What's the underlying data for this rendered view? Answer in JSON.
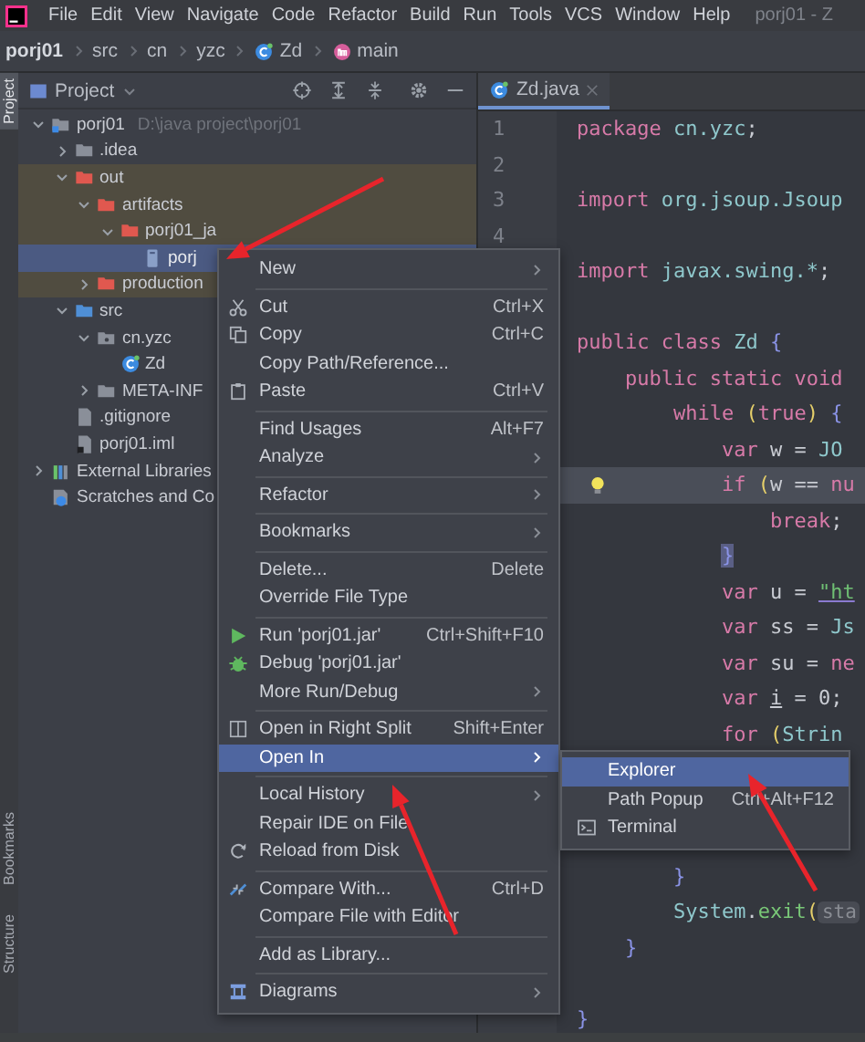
{
  "menubar": {
    "items": [
      "File",
      "Edit",
      "View",
      "Navigate",
      "Code",
      "Refactor",
      "Build",
      "Run",
      "Tools",
      "VCS",
      "Window",
      "Help"
    ],
    "title": "porj01 - Z"
  },
  "breadcrumbs": [
    {
      "label": "porj01",
      "kind": "project"
    },
    {
      "label": "src",
      "kind": "folder"
    },
    {
      "label": "cn",
      "kind": "folder"
    },
    {
      "label": "yzc",
      "kind": "folder"
    },
    {
      "label": "Zd",
      "kind": "class"
    },
    {
      "label": "main",
      "kind": "method"
    }
  ],
  "tool_stripe": {
    "top": [
      {
        "label": "Project",
        "selected": true
      }
    ],
    "bottom": [
      {
        "label": "Bookmarks",
        "selected": false
      },
      {
        "label": "Structure",
        "selected": false
      }
    ]
  },
  "project_panel": {
    "title": "Project",
    "tree": [
      {
        "label": "porj01",
        "path": "D:\\java project\\porj01",
        "kind": "module",
        "expanded": true,
        "excluded": false,
        "selected": false,
        "children": [
          {
            "label": ".idea",
            "kind": "folder",
            "expanded": false,
            "excluded": false,
            "selected": false
          },
          {
            "label": "out",
            "kind": "folder",
            "expanded": true,
            "excluded": true,
            "selected": false,
            "children": [
              {
                "label": "artifacts",
                "kind": "folder",
                "expanded": true,
                "excluded": true,
                "selected": false,
                "children": [
                  {
                    "label": "porj01_ja",
                    "kind": "folder",
                    "expanded": true,
                    "excluded": true,
                    "selected": false,
                    "children": [
                      {
                        "label": "porj",
                        "kind": "jar",
                        "excluded": true,
                        "selected": true
                      }
                    ]
                  }
                ]
              },
              {
                "label": "production",
                "kind": "folder",
                "expanded": false,
                "excluded": true,
                "selected": false
              }
            ]
          },
          {
            "label": "src",
            "kind": "source",
            "expanded": true,
            "excluded": false,
            "selected": false,
            "children": [
              {
                "label": "cn.yzc",
                "kind": "package",
                "expanded": true,
                "excluded": false,
                "selected": false,
                "children": [
                  {
                    "label": "Zd",
                    "kind": "class",
                    "excluded": false,
                    "selected": false
                  }
                ]
              },
              {
                "label": "META-INF",
                "kind": "folder",
                "expanded": false,
                "excluded": false,
                "selected": false
              }
            ]
          },
          {
            "label": ".gitignore",
            "kind": "file",
            "excluded": false,
            "selected": false
          },
          {
            "label": "porj01.iml",
            "kind": "iml",
            "excluded": false,
            "selected": false
          }
        ]
      },
      {
        "label": "External Libraries",
        "kind": "libraries",
        "expanded": false,
        "excluded": false,
        "selected": false
      },
      {
        "label": "Scratches and Co",
        "kind": "scratches",
        "excluded": false,
        "selected": false
      }
    ]
  },
  "editor": {
    "tabs": [
      {
        "label": "Zd.java",
        "selected": true
      }
    ],
    "line_numbers": [
      "1",
      "2",
      "3",
      "4"
    ],
    "lines": [
      {
        "current": false,
        "tokens": [
          {
            "text": "package",
            "kind": "kw"
          },
          {
            "text": " cn.yzc",
            "kind": "id"
          },
          {
            "text": ";",
            "kind": "plain"
          }
        ]
      },
      {
        "current": false
      },
      {
        "current": false,
        "tokens": [
          {
            "text": "import",
            "kind": "kw"
          },
          {
            "text": " org.jsoup.Jsoup",
            "kind": "id"
          }
        ]
      },
      {
        "current": false
      },
      {
        "current": false,
        "tokens": [
          {
            "text": "import",
            "kind": "kw"
          },
          {
            "text": " javax.swing.*",
            "kind": "id"
          },
          {
            "text": ";",
            "kind": "plain"
          }
        ]
      },
      {
        "current": false
      },
      {
        "current": false,
        "tokens": [
          {
            "text": "public class",
            "kind": "kw"
          },
          {
            "text": " Zd",
            "kind": "id"
          },
          {
            "text": " {",
            "kind": "brace"
          }
        ]
      },
      {
        "current": false,
        "tokens": [
          {
            "text": "    public static void",
            "kind": "kw"
          }
        ]
      },
      {
        "current": false,
        "tokens": [
          {
            "text": "        while",
            "kind": "kw"
          },
          {
            "text": " (",
            "kind": "paren"
          },
          {
            "text": "true",
            "kind": "kw"
          },
          {
            "text": ")",
            "kind": "paren"
          },
          {
            "text": " {",
            "kind": "brace"
          }
        ]
      },
      {
        "current": false,
        "tokens": [
          {
            "text": "            var",
            "kind": "kw"
          },
          {
            "text": " w = ",
            "kind": "plain"
          },
          {
            "text": "JO",
            "kind": "id"
          }
        ]
      },
      {
        "current": true,
        "tokens": [
          {
            "text": "            if",
            "kind": "kw"
          },
          {
            "text": " (",
            "kind": "paren"
          },
          {
            "text": "w == ",
            "kind": "plain"
          },
          {
            "text": "nu",
            "kind": "kw"
          }
        ]
      },
      {
        "current": false,
        "tokens": [
          {
            "text": "                break",
            "kind": "kw"
          },
          {
            "text": ";",
            "kind": "plain"
          }
        ]
      },
      {
        "current": false,
        "tokens": [
          {
            "text": "}",
            "kind": "brace_hl"
          }
        ]
      },
      {
        "current": false,
        "tokens": [
          {
            "text": "            var",
            "kind": "kw"
          },
          {
            "text": " u = ",
            "kind": "plain"
          },
          {
            "text": "\"ht",
            "kind": "str"
          }
        ]
      },
      {
        "current": false,
        "tokens": [
          {
            "text": "            var",
            "kind": "kw"
          },
          {
            "text": " ss = ",
            "kind": "plain"
          },
          {
            "text": "Js",
            "kind": "id"
          }
        ]
      },
      {
        "current": false,
        "tokens": [
          {
            "text": "            var",
            "kind": "kw"
          },
          {
            "text": " su = ",
            "kind": "plain"
          },
          {
            "text": "ne",
            "kind": "kw"
          }
        ]
      },
      {
        "current": false,
        "tokens": [
          {
            "text": "            var",
            "kind": "kw"
          },
          {
            "text": "i",
            "kind": "var_ul"
          },
          {
            "text": " = 0;",
            "kind": "plain"
          }
        ]
      },
      {
        "current": false,
        "tokens": [
          {
            "text": "            for",
            "kind": "kw"
          },
          {
            "text": " (",
            "kind": "paren"
          },
          {
            "text": "Strin",
            "kind": "id"
          }
        ]
      },
      {
        "current": false
      },
      {
        "current": false
      },
      {
        "current": false
      },
      {
        "current": false,
        "tokens": [
          {
            "text": "        }",
            "kind": "brace"
          }
        ]
      },
      {
        "current": false,
        "tokens": [
          {
            "text": "        System",
            "kind": "id"
          },
          {
            "text": ".",
            "kind": "plain"
          },
          {
            "text": "exit",
            "kind": "fn"
          },
          {
            "text": "(",
            "kind": "paren"
          },
          {
            "text": "sta",
            "kind": "hint"
          }
        ]
      },
      {
        "current": false,
        "tokens": [
          {
            "text": "    }",
            "kind": "brace"
          }
        ]
      },
      {
        "current": false
      },
      {
        "current": false,
        "tokens": [
          {
            "text": "}",
            "kind": "brace"
          }
        ]
      }
    ]
  },
  "context_menu": {
    "sections": [
      [
        {
          "label": "New",
          "kind": "plain",
          "submenu": true,
          "selected": false
        }
      ],
      [
        {
          "label": "Cut",
          "shortcut": "Ctrl+X",
          "kind": "scissors",
          "submenu": false,
          "selected": false
        },
        {
          "label": "Copy",
          "shortcut": "Ctrl+C",
          "kind": "copy",
          "submenu": false,
          "selected": false
        },
        {
          "label": "Copy Path/Reference...",
          "kind": "plain",
          "submenu": false,
          "selected": false
        },
        {
          "label": "Paste",
          "shortcut": "Ctrl+V",
          "kind": "clipboard",
          "submenu": false,
          "selected": false
        }
      ],
      [
        {
          "label": "Find Usages",
          "shortcut": "Alt+F7",
          "kind": "plain",
          "submenu": false,
          "selected": false
        },
        {
          "label": "Analyze",
          "kind": "plain",
          "submenu": true,
          "selected": false
        }
      ],
      [
        {
          "label": "Refactor",
          "kind": "plain",
          "submenu": true,
          "selected": false
        }
      ],
      [
        {
          "label": "Bookmarks",
          "kind": "plain",
          "submenu": true,
          "selected": false
        }
      ],
      [
        {
          "label": "Delete...",
          "shortcut": "Delete",
          "kind": "plain",
          "submenu": false,
          "selected": false
        },
        {
          "label": "Override File Type",
          "kind": "plain",
          "submenu": false,
          "selected": false
        }
      ],
      [
        {
          "label": "Run 'porj01.jar'",
          "shortcut": "Ctrl+Shift+F10",
          "kind": "play",
          "submenu": false,
          "selected": false
        },
        {
          "label": "Debug 'porj01.jar'",
          "kind": "bug",
          "submenu": false,
          "selected": false
        },
        {
          "label": "More Run/Debug",
          "kind": "plain",
          "submenu": true,
          "selected": false
        }
      ],
      [
        {
          "label": "Open in Right Split",
          "shortcut": "Shift+Enter",
          "kind": "split",
          "submenu": false,
          "selected": false
        },
        {
          "label": "Open In",
          "kind": "plain",
          "submenu": true,
          "selected": true
        }
      ],
      [
        {
          "label": "Local History",
          "kind": "plain",
          "submenu": true,
          "selected": false
        },
        {
          "label": "Repair IDE on File",
          "kind": "plain",
          "submenu": false,
          "selected": false
        },
        {
          "label": "Reload from Disk",
          "kind": "reload",
          "submenu": false,
          "selected": false
        }
      ],
      [
        {
          "label": "Compare With...",
          "shortcut": "Ctrl+D",
          "kind": "compare",
          "submenu": false,
          "selected": false
        },
        {
          "label": "Compare File with Editor",
          "kind": "plain",
          "submenu": false,
          "selected": false
        }
      ],
      [
        {
          "label": "Add as Library...",
          "kind": "plain",
          "submenu": false,
          "selected": false
        }
      ],
      [
        {
          "label": "Diagrams",
          "kind": "diagram",
          "submenu": true,
          "selected": false
        }
      ]
    ]
  },
  "submenu": {
    "items": [
      {
        "label": "Explorer",
        "kind": "plain",
        "selected": true
      },
      {
        "label": "Path Popup",
        "shortcut": "Ctrl+Alt+F12",
        "kind": "plain",
        "selected": false
      },
      {
        "label": "Terminal",
        "kind": "terminal",
        "selected": false
      }
    ]
  },
  "annotations": [
    {
      "kind": "arrow"
    },
    {
      "kind": "arrow"
    },
    {
      "kind": "arrow"
    }
  ]
}
